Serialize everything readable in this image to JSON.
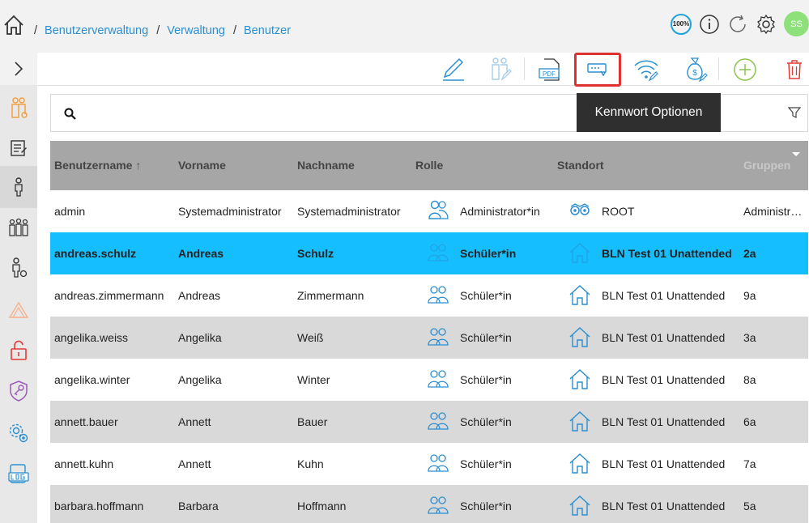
{
  "breadcrumb": {
    "separator": "/",
    "items": [
      "Benutzerverwaltung",
      "Verwaltung",
      "Benutzer"
    ]
  },
  "header": {
    "zoom": "100%",
    "avatar_initials": "SS"
  },
  "tooltip": {
    "text": "Kennwort Optionen"
  },
  "search": {
    "value": "",
    "placeholder": ""
  },
  "table": {
    "columns": [
      "Benutzername",
      "Vorname",
      "Nachname",
      "Rolle",
      "Standort",
      "Gruppen"
    ],
    "rows": [
      {
        "username": "admin",
        "firstname": "Systemadministrator",
        "lastname": "Systemadministrator",
        "role": "Administrator*in",
        "location": "ROOT",
        "groups": "Administr…"
      },
      {
        "username": "andreas.schulz",
        "firstname": "Andreas",
        "lastname": "Schulz",
        "role": "Schüler*in",
        "location": "BLN Test 01 Unattended",
        "groups": "2a"
      },
      {
        "username": "andreas.zimmermann",
        "firstname": "Andreas",
        "lastname": "Zimmermann",
        "role": "Schüler*in",
        "location": "BLN Test 01 Unattended",
        "groups": "9a"
      },
      {
        "username": "angelika.weiss",
        "firstname": "Angelika",
        "lastname": "Weiß",
        "role": "Schüler*in",
        "location": "BLN Test 01 Unattended",
        "groups": "3a"
      },
      {
        "username": "angelika.winter",
        "firstname": "Angelika",
        "lastname": "Winter",
        "role": "Schüler*in",
        "location": "BLN Test 01 Unattended",
        "groups": "8a"
      },
      {
        "username": "annett.bauer",
        "firstname": "Annett",
        "lastname": "Bauer",
        "role": "Schüler*in",
        "location": "BLN Test 01 Unattended",
        "groups": "6a"
      },
      {
        "username": "annett.kuhn",
        "firstname": "Annett",
        "lastname": "Kuhn",
        "role": "Schüler*in",
        "location": "BLN Test 01 Unattended",
        "groups": "7a"
      },
      {
        "username": "barbara.hoffmann",
        "firstname": "Barbara",
        "lastname": "Hoffmann",
        "role": "Schüler*in",
        "location": "BLN Test 01 Unattended",
        "groups": "5a"
      }
    ]
  },
  "colors": {
    "accent": "#2a8fd1",
    "selected_row": "#15beff",
    "header_bg": "#a6a6a6",
    "highlight_border": "#e03131",
    "add_green": "#8bc34a",
    "delete_red": "#e53935"
  }
}
